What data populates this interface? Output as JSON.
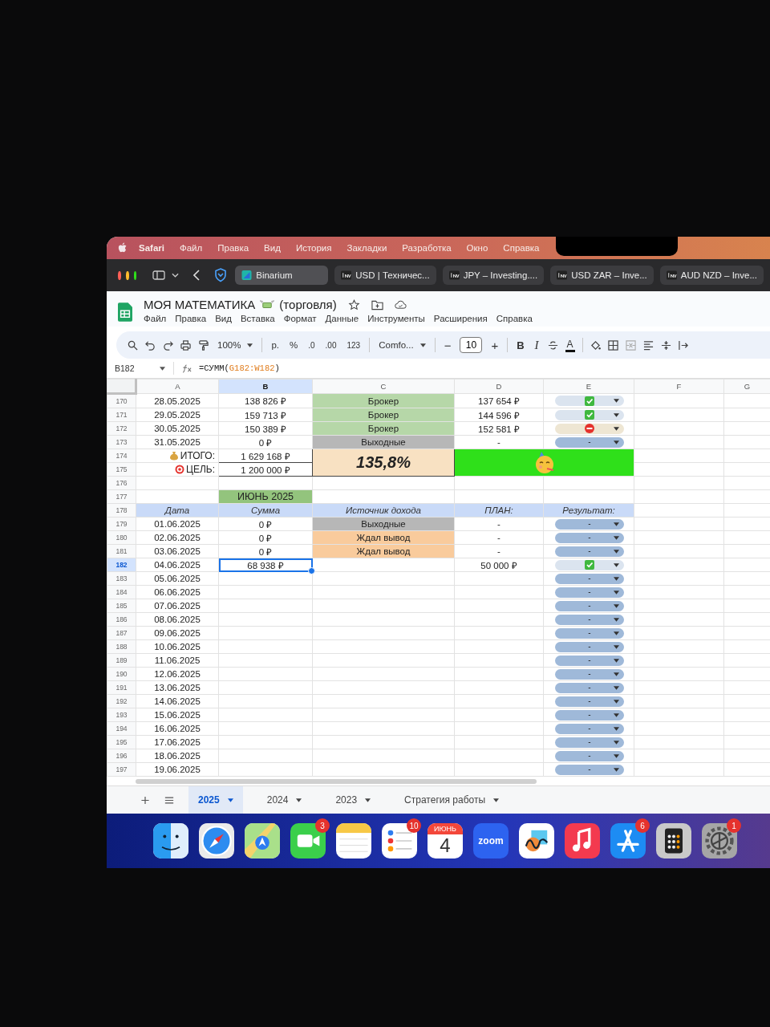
{
  "menu_bar": {
    "app": "Safari",
    "items": [
      "Файл",
      "Правка",
      "Вид",
      "История",
      "Закладки",
      "Разработка",
      "Окно",
      "Справка"
    ]
  },
  "browser_tabs": [
    {
      "label": "Binarium",
      "selected": true
    },
    {
      "label": "USD | Техничес...",
      "selected": false
    },
    {
      "label": "JPY – Investing....",
      "selected": false
    },
    {
      "label": "USD ZAR – Inve...",
      "selected": false
    },
    {
      "label": "AUD NZD – Inve...",
      "selected": false
    }
  ],
  "document": {
    "title": "МОЯ МАТЕМАТИКА",
    "title_suffix": "(торговля)",
    "menu": [
      "Файл",
      "Правка",
      "Вид",
      "Вставка",
      "Формат",
      "Данные",
      "Инструменты",
      "Расширения",
      "Справка"
    ]
  },
  "toolbar": {
    "zoom": "100%",
    "currency": "р.",
    "percent": "%",
    "decrease_decimals": ".0",
    "increase_decimals": ".00",
    "number_format": "123",
    "font": "Comfo...",
    "minus": "−",
    "font_size": "10",
    "plus": "+",
    "bold": "B",
    "italic": "I",
    "text_color": "A"
  },
  "formula_bar": {
    "cell": "B182",
    "start": "=СУММ(",
    "range": "G182:W182",
    "end": ")"
  },
  "columns": [
    {
      "label": "A",
      "selected": false
    },
    {
      "label": "B",
      "selected": true
    },
    {
      "label": "C",
      "selected": false
    },
    {
      "label": "D",
      "selected": false
    },
    {
      "label": "E",
      "selected": false
    },
    {
      "label": "F",
      "selected": false
    },
    {
      "label": "G",
      "selected": false
    }
  ],
  "rows": [
    {
      "kind": "day",
      "number": "170",
      "selected": false,
      "date": "28.05.2025",
      "sum": "138 826 ₽",
      "source": {
        "text": "Брокер",
        "color": "#b6d7a8"
      },
      "plan": "137 654 ₽",
      "result": {
        "kind": "check"
      }
    },
    {
      "kind": "day",
      "number": "171",
      "selected": false,
      "date": "29.05.2025",
      "sum": "159 713 ₽",
      "source": {
        "text": "Брокер",
        "color": "#b6d7a8"
      },
      "plan": "144 596 ₽",
      "result": {
        "kind": "check"
      }
    },
    {
      "kind": "day",
      "number": "172",
      "selected": false,
      "date": "30.05.2025",
      "sum": "150 389 ₽",
      "source": {
        "text": "Брокер",
        "color": "#b6d7a8"
      },
      "plan": "152 581 ₽",
      "result": {
        "kind": "stop"
      }
    },
    {
      "kind": "day",
      "number": "173",
      "selected": false,
      "date": "31.05.2025",
      "sum": "0 ₽",
      "source": {
        "text": "Выходные",
        "color": "#b7b7b7"
      },
      "plan": "-",
      "result": {
        "kind": "empty",
        "label": "-"
      }
    },
    {
      "kind": "total",
      "number": "174",
      "selected": false,
      "label": "ИТОГО:",
      "sum": "1 629 168 ₽",
      "percent": "135,8%"
    },
    {
      "kind": "goal",
      "number": "175",
      "selected": false,
      "label": "ЦЕЛЬ:",
      "sum": "1 200 000 ₽"
    },
    {
      "kind": "blank",
      "number": "176",
      "selected": false
    },
    {
      "kind": "month",
      "number": "177",
      "selected": false,
      "title": "ИЮНЬ 2025"
    },
    {
      "kind": "header",
      "number": "178",
      "selected": false,
      "cells": [
        "Дата",
        "Сумма",
        "Источник дохода",
        "ПЛАН:",
        "Результат:"
      ]
    },
    {
      "kind": "day",
      "number": "179",
      "selected": false,
      "date": "01.06.2025",
      "sum": "0 ₽",
      "source": {
        "text": "Выходные",
        "color": "#b7b7b7"
      },
      "plan": "-",
      "result": {
        "kind": "empty",
        "label": "-"
      }
    },
    {
      "kind": "day",
      "number": "180",
      "selected": false,
      "date": "02.06.2025",
      "sum": "0 ₽",
      "source": {
        "text": "Ждал вывод",
        "color": "#f9cb9c"
      },
      "plan": "-",
      "result": {
        "kind": "empty",
        "label": "-"
      }
    },
    {
      "kind": "day",
      "number": "181",
      "selected": false,
      "date": "03.06.2025",
      "sum": "0 ₽",
      "source": {
        "text": "Ждал вывод",
        "color": "#f9cb9c"
      },
      "plan": "-",
      "result": {
        "kind": "empty",
        "label": "-"
      }
    },
    {
      "kind": "day",
      "number": "182",
      "selected": true,
      "date": "04.06.2025",
      "sum": "68 938 ₽",
      "plan": "50 000 ₽",
      "result": {
        "kind": "check"
      }
    },
    {
      "kind": "day",
      "number": "183",
      "selected": false,
      "date": "05.06.2025",
      "result": {
        "kind": "empty",
        "label": "-"
      }
    },
    {
      "kind": "day",
      "number": "184",
      "selected": false,
      "date": "06.06.2025",
      "result": {
        "kind": "empty",
        "label": "-"
      }
    },
    {
      "kind": "day",
      "number": "185",
      "selected": false,
      "date": "07.06.2025",
      "result": {
        "kind": "empty",
        "label": "-"
      }
    },
    {
      "kind": "day",
      "number": "186",
      "selected": false,
      "date": "08.06.2025",
      "result": {
        "kind": "empty",
        "label": "-"
      }
    },
    {
      "kind": "day",
      "number": "187",
      "selected": false,
      "date": "09.06.2025",
      "result": {
        "kind": "empty",
        "label": "-"
      }
    },
    {
      "kind": "day",
      "number": "188",
      "selected": false,
      "date": "10.06.2025",
      "result": {
        "kind": "empty",
        "label": "-"
      }
    },
    {
      "kind": "day",
      "number": "189",
      "selected": false,
      "date": "11.06.2025",
      "result": {
        "kind": "empty",
        "label": "-"
      }
    },
    {
      "kind": "day",
      "number": "190",
      "selected": false,
      "date": "12.06.2025",
      "result": {
        "kind": "empty",
        "label": "-"
      }
    },
    {
      "kind": "day",
      "number": "191",
      "selected": false,
      "date": "13.06.2025",
      "result": {
        "kind": "empty",
        "label": "-"
      }
    },
    {
      "kind": "day",
      "number": "192",
      "selected": false,
      "date": "14.06.2025",
      "result": {
        "kind": "empty",
        "label": "-"
      }
    },
    {
      "kind": "day",
      "number": "193",
      "selected": false,
      "date": "15.06.2025",
      "result": {
        "kind": "empty",
        "label": "-"
      }
    },
    {
      "kind": "day",
      "number": "194",
      "selected": false,
      "date": "16.06.2025",
      "result": {
        "kind": "empty",
        "label": "-"
      }
    },
    {
      "kind": "day",
      "number": "195",
      "selected": false,
      "date": "17.06.2025",
      "result": {
        "kind": "empty",
        "label": "-"
      }
    },
    {
      "kind": "day",
      "number": "196",
      "selected": false,
      "date": "18.06.2025",
      "result": {
        "kind": "empty",
        "label": "-"
      }
    },
    {
      "kind": "day",
      "number": "197",
      "selected": false,
      "date": "19.06.2025",
      "result": {
        "kind": "empty",
        "label": "-"
      }
    }
  ],
  "sheet_tabs": [
    {
      "label": "2025",
      "selected": true
    },
    {
      "label": "2024",
      "selected": false
    },
    {
      "label": "2023",
      "selected": false
    },
    {
      "label": "Стратегия работы",
      "selected": false
    }
  ],
  "dock": [
    {
      "kind": "finder"
    },
    {
      "kind": "safari"
    },
    {
      "kind": "maps"
    },
    {
      "kind": "facetime",
      "badge": "3"
    },
    {
      "kind": "notes"
    },
    {
      "kind": "reminders",
      "badge": "10"
    },
    {
      "kind": "calendar",
      "month": "ИЮНЬ",
      "day": "4"
    },
    {
      "kind": "zoom",
      "label": "zoom"
    },
    {
      "kind": "freeform"
    },
    {
      "kind": "music"
    },
    {
      "kind": "appstore",
      "badge": "6"
    },
    {
      "kind": "calculator"
    },
    {
      "kind": "settings",
      "badge": "1"
    }
  ]
}
